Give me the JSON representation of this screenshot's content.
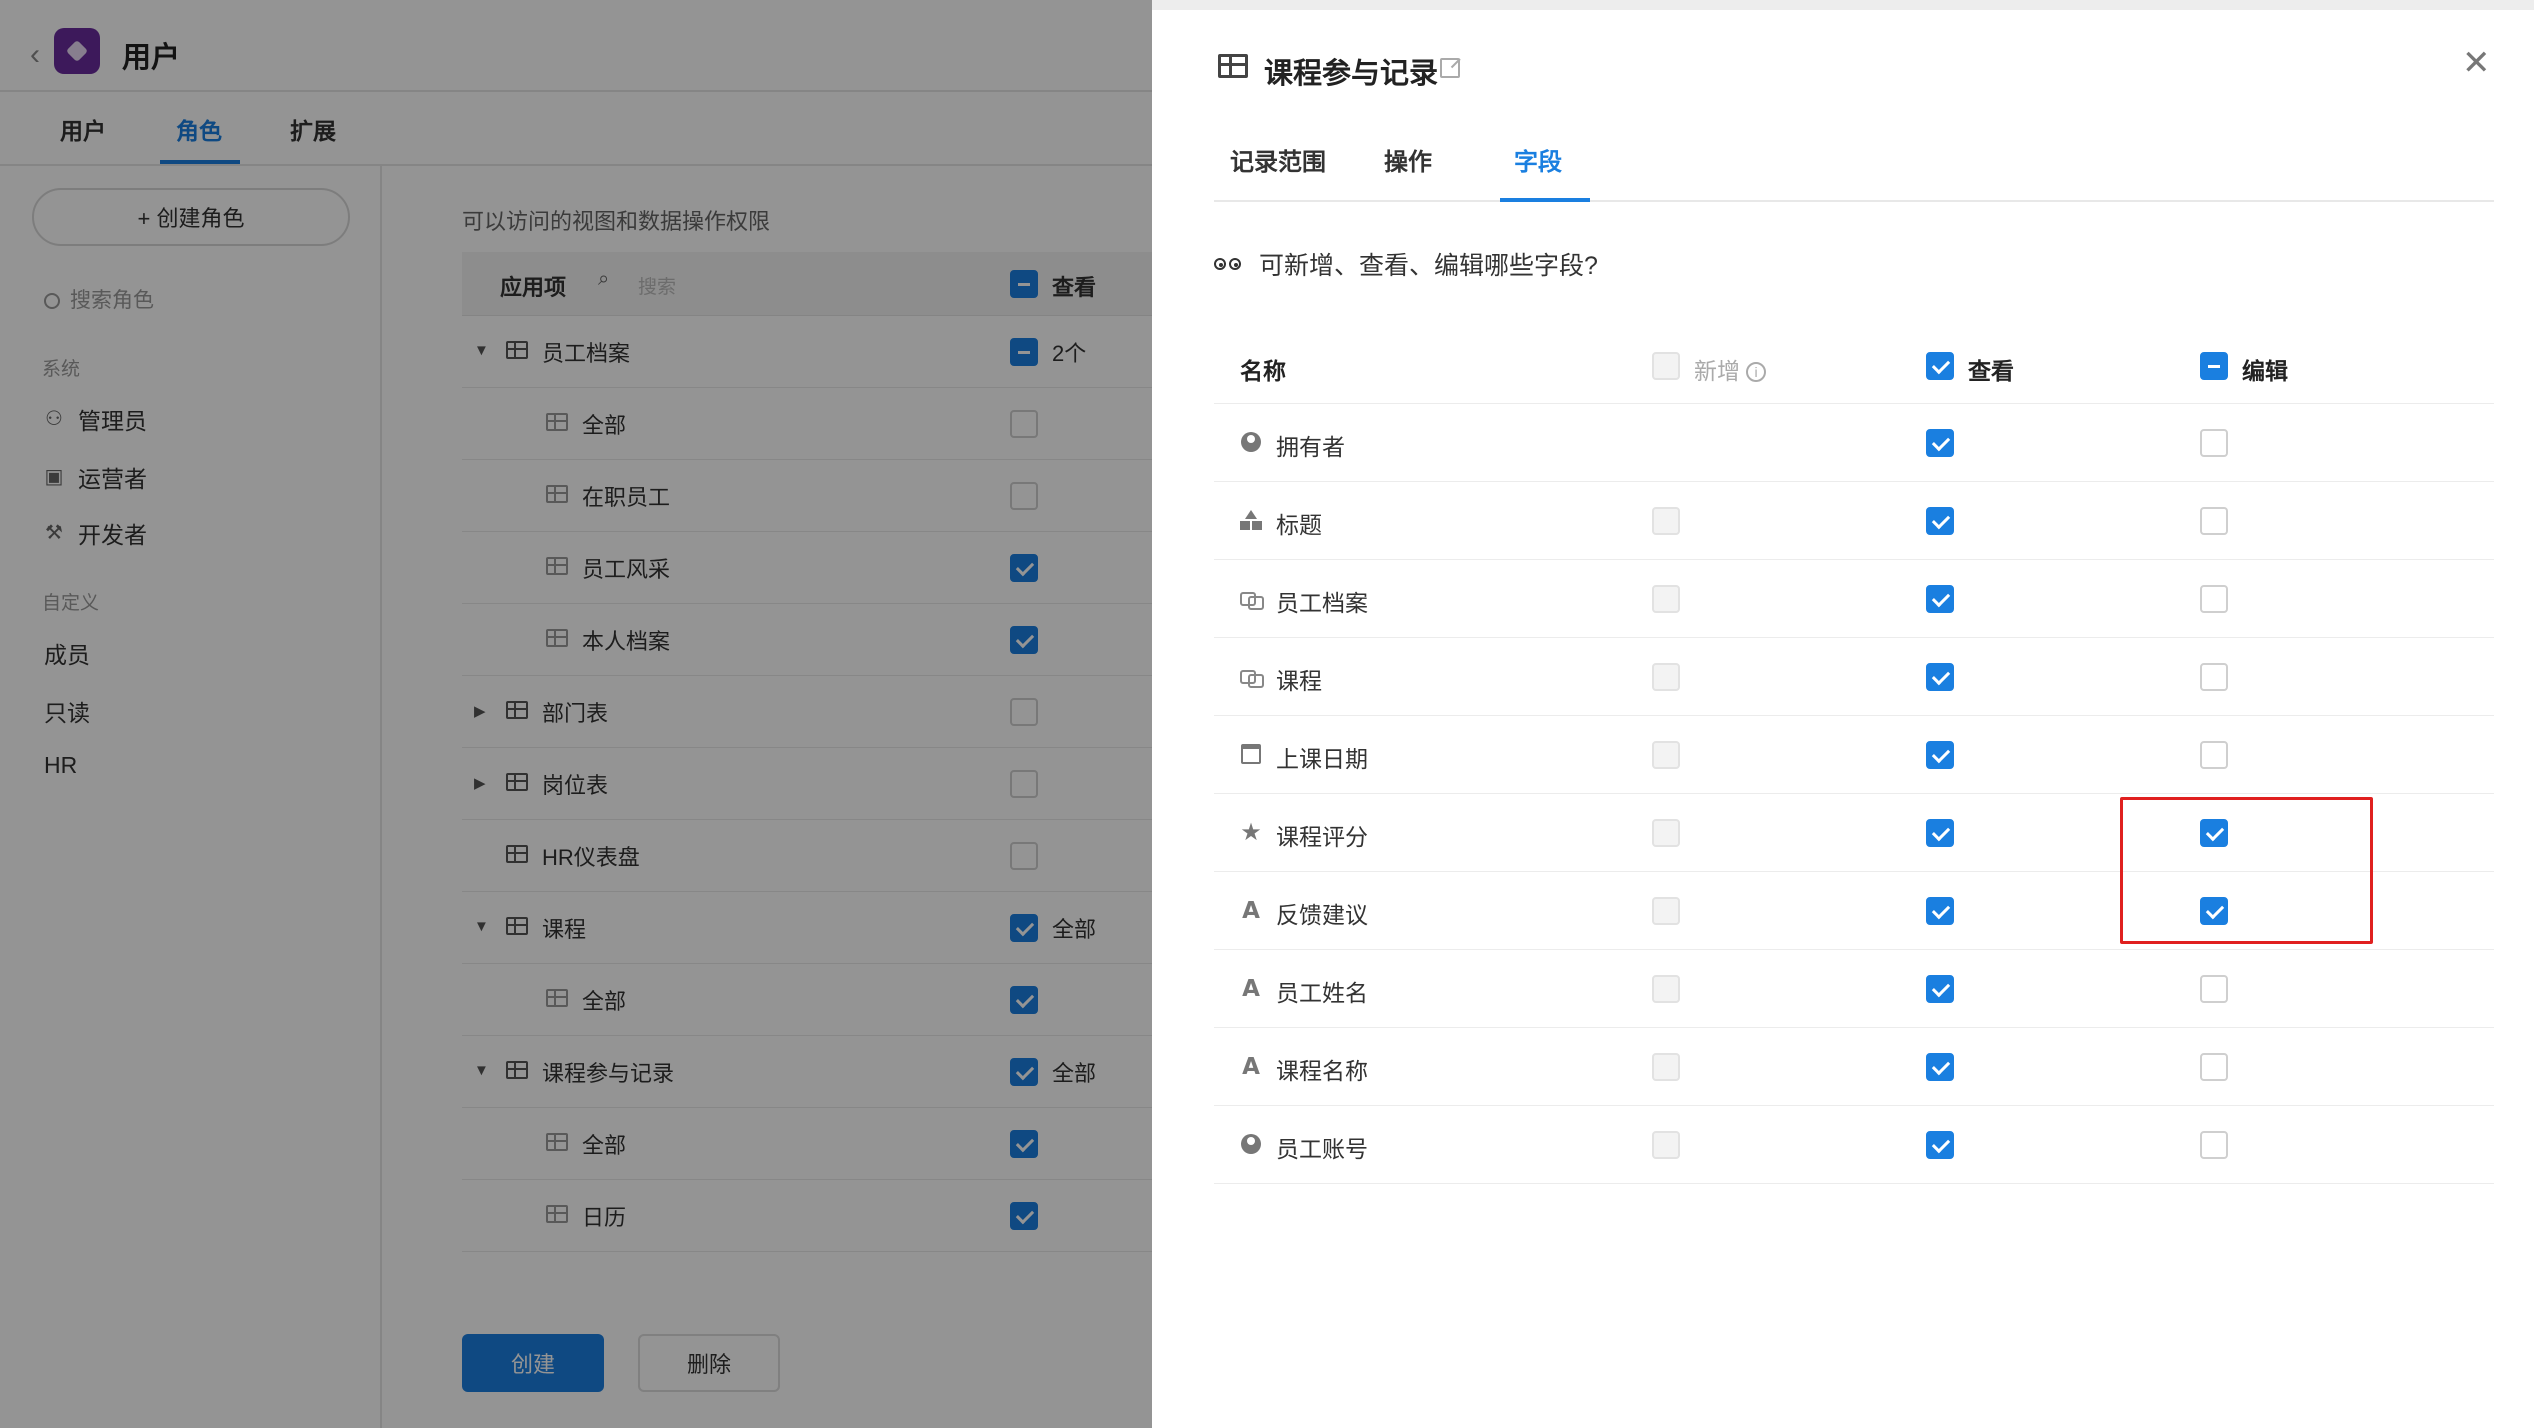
{
  "app": {
    "title": "用户",
    "tabs": [
      {
        "label": "用户"
      },
      {
        "label": "角色"
      },
      {
        "label": "扩展"
      }
    ]
  },
  "sidebar": {
    "create_role": "+ 创建角色",
    "search_placeholder": "搜索角色",
    "group_system": "系统",
    "system_items": [
      {
        "label": "管理员",
        "icon": "admin-icon"
      },
      {
        "label": "运营者",
        "icon": "id-card-icon"
      },
      {
        "label": "开发者",
        "icon": "tools-icon"
      }
    ],
    "group_custom": "自定义",
    "custom_items": [
      {
        "label": "成员"
      },
      {
        "label": "只读"
      },
      {
        "label": "HR"
      }
    ]
  },
  "main": {
    "caption": "可以访问的视图和数据操作权限",
    "head_label": "应用项",
    "head_search": "搜索",
    "head_view": "查看",
    "rows": [
      {
        "label": "员工档案",
        "ext": "2个"
      },
      {
        "label": "全部",
        "ext": ""
      },
      {
        "label": "在职员工",
        "ext": ""
      },
      {
        "label": "员工风采",
        "ext": ""
      },
      {
        "label": "本人档案",
        "ext": ""
      },
      {
        "label": "部门表",
        "ext": ""
      },
      {
        "label": "岗位表",
        "ext": ""
      },
      {
        "label": "HR仪表盘",
        "ext": ""
      },
      {
        "label": "课程",
        "ext": "全部"
      },
      {
        "label": "全部",
        "ext": ""
      },
      {
        "label": "课程参与记录",
        "ext": "全部"
      },
      {
        "label": "全部",
        "ext": ""
      },
      {
        "label": "日历",
        "ext": ""
      }
    ],
    "create_btn": "创建",
    "delete_btn": "删除"
  },
  "drawer": {
    "title": "课程参与记录",
    "tabs": [
      {
        "label": "记录范围"
      },
      {
        "label": "操作"
      },
      {
        "label": "字段"
      }
    ],
    "question": "可新增、查看、编辑哪些字段?",
    "col_name": "名称",
    "col_add": "新增",
    "col_view": "查看",
    "col_edit": "编辑",
    "fields": [
      {
        "name": "拥有者",
        "icon": "person-icon",
        "edit": false
      },
      {
        "name": "标题",
        "icon": "shapes-icon",
        "edit": false
      },
      {
        "name": "员工档案",
        "icon": "link-icon",
        "edit": false
      },
      {
        "name": "课程",
        "icon": "link-icon",
        "edit": false
      },
      {
        "name": "上课日期",
        "icon": "calendar-icon",
        "edit": false
      },
      {
        "name": "课程评分",
        "icon": "star-icon",
        "edit": true
      },
      {
        "name": "反馈建议",
        "icon": "text-icon",
        "edit": true
      },
      {
        "name": "员工姓名",
        "icon": "text-icon",
        "edit": false
      },
      {
        "name": "课程名称",
        "icon": "text-icon",
        "edit": false
      },
      {
        "name": "员工账号",
        "icon": "person-icon",
        "edit": false
      }
    ]
  },
  "colors": {
    "accent": "#1a7fe0",
    "highlight": "#e0201f",
    "logo": "#6a2b9e"
  }
}
